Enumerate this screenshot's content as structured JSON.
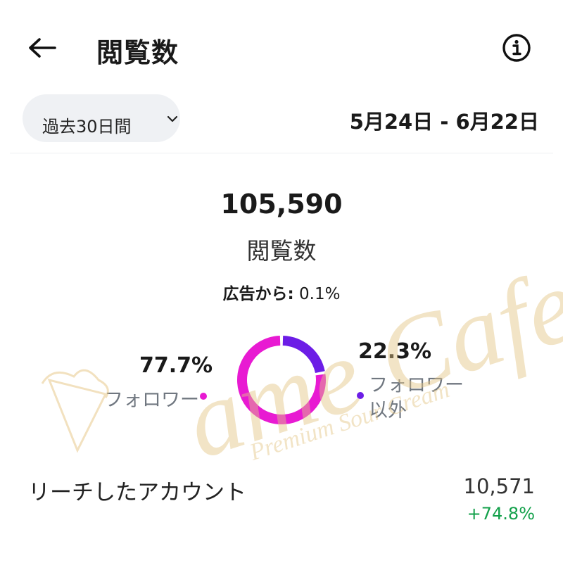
{
  "header": {
    "title": "閲覧数",
    "back_icon": "arrow-left-icon",
    "info_icon": "info-icon"
  },
  "filter": {
    "period_label": "過去30日間",
    "chevron_icon": "chevron-down-icon",
    "date_range": "5月24日 - 6月22日"
  },
  "summary": {
    "total_value": "105,590",
    "total_label": "閲覧数",
    "ads_label": "広告から:",
    "ads_value": "0.1%"
  },
  "breakdown": {
    "follower": {
      "percent": "77.7%",
      "label": "フォロワー",
      "color": "#e81ad2",
      "fraction": 0.777
    },
    "non_follower": {
      "percent": "22.3%",
      "label": "フォロワー以外",
      "color": "#6c1de6",
      "fraction": 0.223
    }
  },
  "reach": {
    "label": "リーチしたアカウント",
    "value": "10,571",
    "change": "+74.8%",
    "change_color": "#12a04a"
  },
  "watermark": {
    "title": "ame Cafe",
    "subtitle": "Premium Sour Cream"
  }
}
